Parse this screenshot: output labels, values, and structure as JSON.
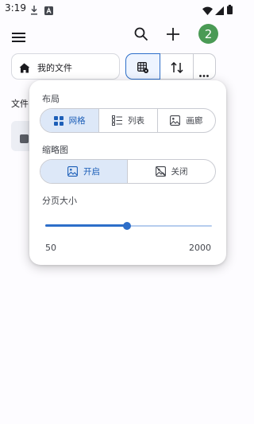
{
  "status_bar": {
    "time": "3:19",
    "icons": [
      "download-icon",
      "app-notification-icon",
      "wifi-icon",
      "signal-icon",
      "battery-icon"
    ]
  },
  "app_bar": {
    "icons": [
      "menu-icon",
      "search-icon",
      "add-icon"
    ],
    "avatar_text": "2",
    "avatar_color": "#4a9a55"
  },
  "breadcrumb": {
    "label": "我的文件",
    "icon": "home-icon"
  },
  "toolbar": {
    "view_icon": "grid-settings-icon",
    "sort_icon": "sort-icon",
    "more_icon": "more-horizontal-icon",
    "active_color": "#2d6ec9"
  },
  "background": {
    "section_label": "文件"
  },
  "popup": {
    "layout": {
      "title": "布局",
      "options": [
        {
          "label": "网格",
          "icon": "grid-icon",
          "selected": true
        },
        {
          "label": "列表",
          "icon": "list-icon",
          "selected": false
        },
        {
          "label": "画廊",
          "icon": "gallery-icon",
          "selected": false
        }
      ]
    },
    "thumbnail": {
      "title": "缩略图",
      "options": [
        {
          "label": "开启",
          "icon": "image-icon",
          "selected": true
        },
        {
          "label": "关闭",
          "icon": "image-off-icon",
          "selected": false
        }
      ]
    },
    "page_size": {
      "title": "分页大小",
      "min_label": "50",
      "max_label": "2000",
      "level": 0.49
    }
  }
}
